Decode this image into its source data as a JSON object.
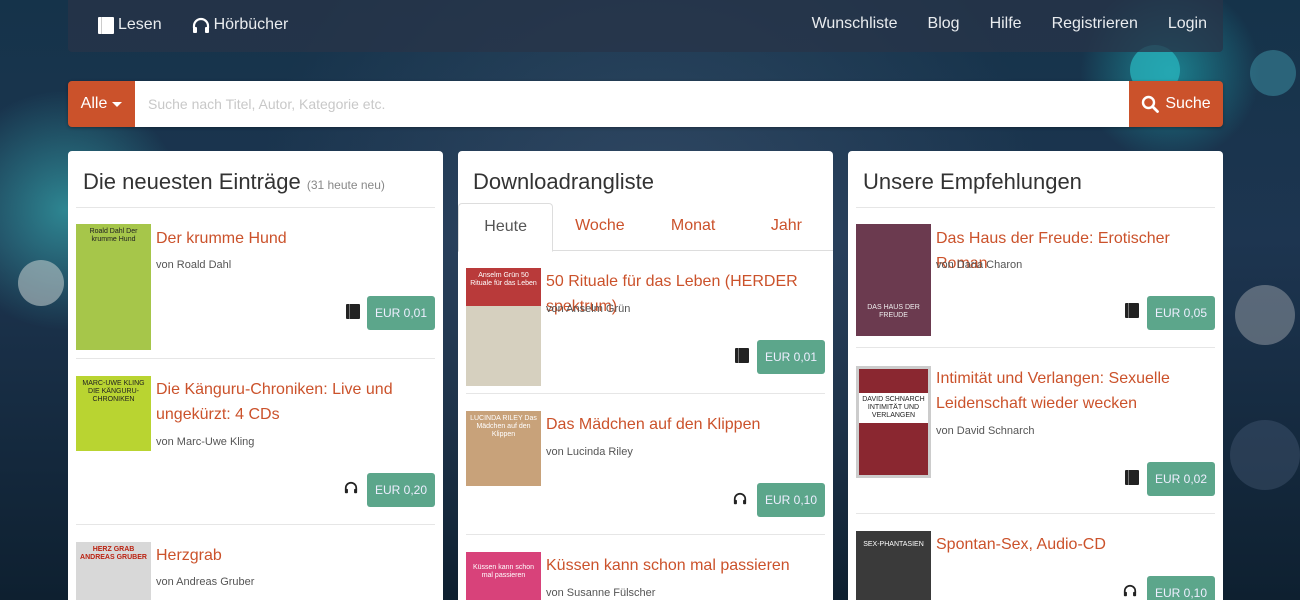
{
  "nav": {
    "left": [
      {
        "label": "Lesen",
        "icon": "book-icon"
      },
      {
        "label": "Hörbücher",
        "icon": "headphones-icon"
      }
    ],
    "right": [
      "Wunschliste",
      "Blog",
      "Hilfe",
      "Registrieren",
      "Login"
    ]
  },
  "search": {
    "category": "Alle",
    "placeholder": "Suche nach Titel, Autor, Kategorie etc.",
    "button": "Suche"
  },
  "panels": {
    "newest": {
      "title": "Die neuesten Einträge",
      "note": "(31 heute neu)",
      "items": [
        {
          "cover_text": "Roald Dahl Der krumme Hund",
          "title": "Der krumme Hund",
          "author": "von Roald Dahl",
          "format": "book-icon",
          "price": "EUR 0,01",
          "cover_color": "#a6c64a"
        },
        {
          "cover_text": "MARC-UWE KLING DIE KÄNGURU-CHRONIKEN",
          "title": "Die Känguru-Chroniken: Live und ungekürzt: 4 CDs",
          "author": "von Marc-Uwe Kling",
          "format": "headphones-icon",
          "price": "EUR 0,20",
          "cover_color": "#b9d431"
        },
        {
          "cover_text": "HERZ GRAB ANDREAS GRUBER",
          "title": "Herzgrab",
          "author": "von Andreas Gruber",
          "format": "book-icon",
          "price": "",
          "cover_color": "#d8d8d8"
        }
      ]
    },
    "downloads": {
      "title": "Downloadrangliste",
      "tabs": [
        "Heute",
        "Woche",
        "Monat",
        "Jahr"
      ],
      "active_tab": "Heute",
      "items": [
        {
          "cover_text": "Anselm Grün 50 Rituale für das Leben",
          "title": "50 Rituale für das Leben (HERDER spektrum)",
          "author": "von Anselm Grün",
          "format": "book-icon",
          "price": "EUR 0,01",
          "cover_color": "#d6d0bf"
        },
        {
          "cover_text": "LUCINDA RILEY Das Mädchen auf den Klippen",
          "title": "Das Mädchen auf den Klippen",
          "author": "von Lucinda Riley",
          "format": "headphones-icon",
          "price": "EUR 0,10",
          "cover_color": "#c8a27a"
        },
        {
          "cover_text": "Küssen kann schon mal passieren",
          "title": "Küssen kann schon mal passieren",
          "author": "von Susanne Fülscher",
          "format": "book-icon",
          "price": "",
          "cover_color": "#d8427a"
        }
      ]
    },
    "recommendations": {
      "title": "Unsere Empfehlungen",
      "items": [
        {
          "cover_text": "DAS HAUS DER FREUDE",
          "title": "Das Haus der Freude: Erotischer Roman",
          "author": "von Daria Charon",
          "format": "book-icon",
          "price": "EUR 0,05",
          "cover_color": "#6b3a4f"
        },
        {
          "cover_text": "DAVID SCHNARCH INTIMITÄT UND VERLANGEN",
          "title": "Intimität und Verlangen: Sexuelle Leidenschaft wieder wecken",
          "author": "von David Schnarch",
          "format": "book-icon",
          "price": "EUR 0,02",
          "cover_color": "#8a2730"
        },
        {
          "cover_text": "SEX-PHANTASIEN",
          "title": "Spontan-Sex, Audio-CD",
          "author": "",
          "format": "headphones-icon",
          "price": "EUR 0,10",
          "cover_color": "#3a3a3a"
        }
      ]
    }
  }
}
